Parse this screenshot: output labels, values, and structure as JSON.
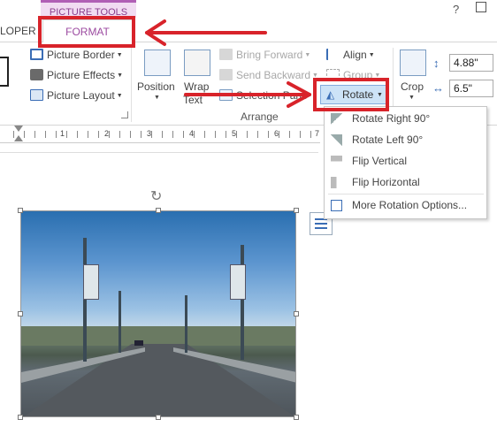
{
  "context_tab_header": "PICTURE TOOLS",
  "tabs": {
    "developer_partial": "LOPER",
    "format": "FORMAT"
  },
  "window": {
    "help": "?"
  },
  "picture_styles_group": {
    "border": "Picture Border",
    "effects": "Picture Effects",
    "layout": "Picture Layout"
  },
  "arrange_group": {
    "position": "Position",
    "wrap_text_1": "Wrap",
    "wrap_text_2": "Text",
    "bring_forward": "Bring Forward",
    "send_backward": "Send Backward",
    "selection_pane": "Selection Pane",
    "align": "Align",
    "group": "Group",
    "rotate": "Rotate",
    "label": "Arrange"
  },
  "size_group": {
    "crop": "Crop",
    "height_value": "4.88\"",
    "width_value": "6.5\""
  },
  "rotate_menu": {
    "items": [
      {
        "label": "Rotate Right 90°"
      },
      {
        "label": "Rotate Left 90°"
      },
      {
        "label": "Flip Vertical"
      },
      {
        "label": "Flip Horizontal"
      },
      {
        "label": "More Rotation Options..."
      }
    ]
  },
  "ruler": {
    "numbers": [
      "1",
      "2",
      "3",
      "4",
      "5",
      "6",
      "7"
    ]
  },
  "colors": {
    "accent_purple": "#9b4aa0",
    "annotation_red": "#d8232a",
    "menu_highlight": "#cde3f7"
  }
}
